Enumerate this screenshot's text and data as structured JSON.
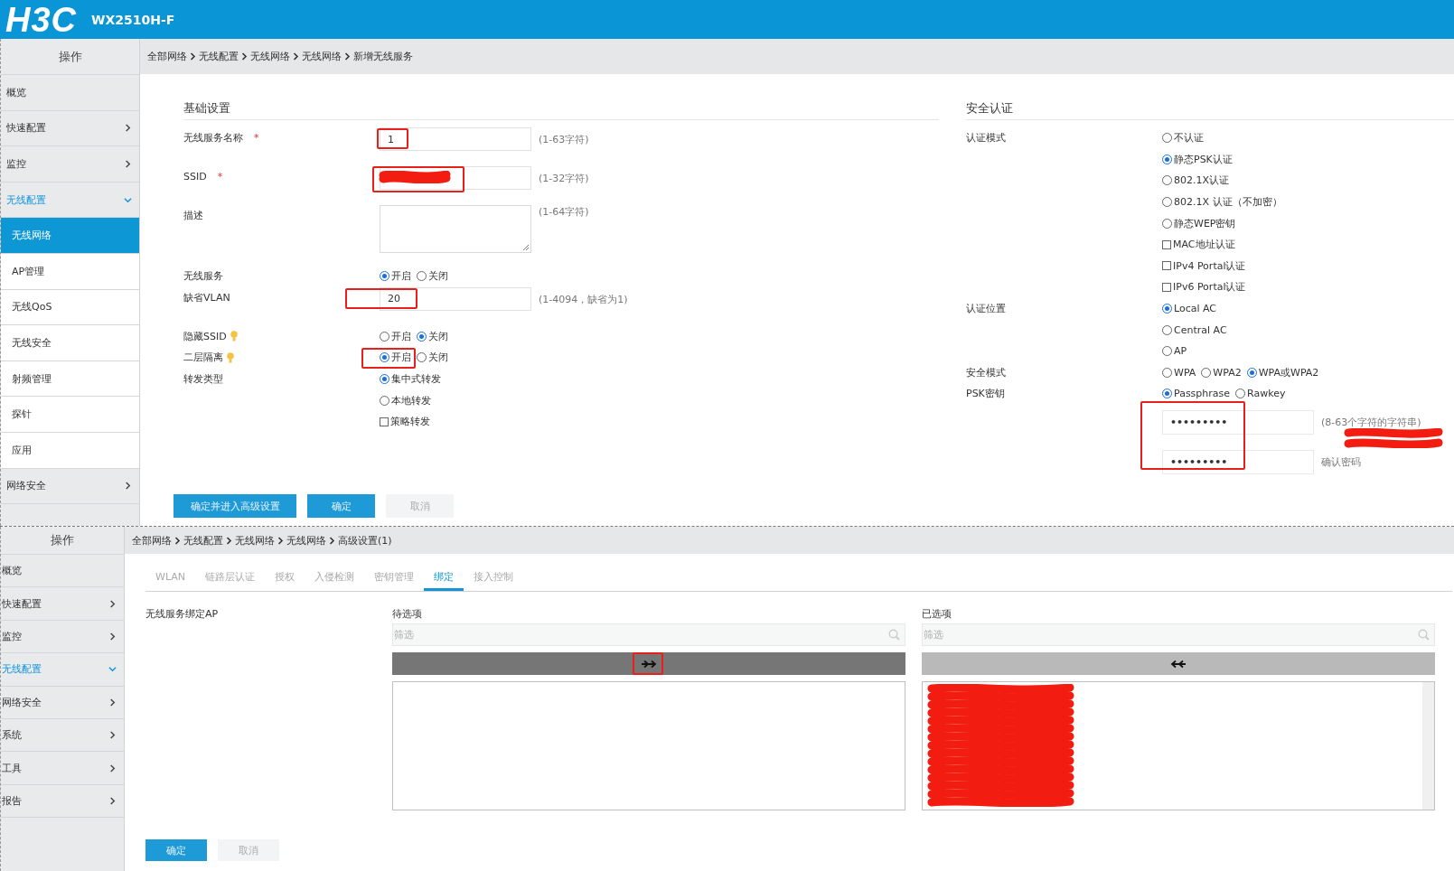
{
  "header": {
    "logo": "H3C",
    "model": "WX2510H-F"
  },
  "top": {
    "sidebar": {
      "title": "操作",
      "items": [
        {
          "label": "概览",
          "kind": "plain",
          "selected": false
        },
        {
          "label": "快速配置",
          "kind": "group",
          "expanded": false,
          "selected": false
        },
        {
          "label": "监控",
          "kind": "group",
          "expanded": false,
          "selected": false
        },
        {
          "label": "无线配置",
          "kind": "group",
          "expanded": true,
          "selected": false
        },
        {
          "label": "无线网络",
          "kind": "sub",
          "selected": true
        },
        {
          "label": "AP管理",
          "kind": "sub",
          "selected": false
        },
        {
          "label": "无线QoS",
          "kind": "sub",
          "selected": false
        },
        {
          "label": "无线安全",
          "kind": "sub",
          "selected": false
        },
        {
          "label": "射频管理",
          "kind": "sub",
          "selected": false
        },
        {
          "label": "探针",
          "kind": "sub",
          "selected": false
        },
        {
          "label": "应用",
          "kind": "sub",
          "selected": false
        },
        {
          "label": "网络安全",
          "kind": "group",
          "expanded": false,
          "selected": false
        }
      ]
    },
    "breadcrumb": [
      "全部网络",
      "无线配置",
      "无线网络",
      "无线网络",
      "新增无线服务"
    ],
    "basic": {
      "title": "基础设置",
      "rows": [
        {
          "kind": "text",
          "label": "无线服务名称",
          "mark": "*",
          "value": "1",
          "hint": "(1-63字符)",
          "annotated": true
        },
        {
          "kind": "text",
          "label": "SSID",
          "mark": "*",
          "value": "",
          "hint": "(1-32字符)",
          "annotated": true,
          "redacted": true
        },
        {
          "kind": "textarea",
          "label": "描述",
          "hint": "(1-64字符)"
        },
        {
          "kind": "inline",
          "label": "无线服务",
          "options": [
            {
              "kind": "radio",
              "label": "开启",
              "selected": true
            },
            {
              "kind": "radio",
              "label": "关闭",
              "selected": false
            }
          ]
        },
        {
          "kind": "text",
          "label": "缺省VLAN",
          "value": "20",
          "hint": "(1-4094，缺省为1)",
          "annotated": true
        },
        {
          "kind": "inline",
          "label": "隐藏SSID",
          "tip": true,
          "options": [
            {
              "kind": "radio",
              "label": "开启",
              "selected": false
            },
            {
              "kind": "radio",
              "label": "关闭",
              "selected": true
            }
          ]
        },
        {
          "kind": "inline",
          "label": "二层隔离",
          "tip": true,
          "annotated": true,
          "options": [
            {
              "kind": "radio",
              "label": "开启",
              "selected": true
            },
            {
              "kind": "radio",
              "label": "关闭",
              "selected": false
            }
          ]
        },
        {
          "kind": "stacked",
          "label": "转发类型",
          "options": [
            {
              "kind": "radio",
              "label": "集中式转发",
              "selected": true
            },
            {
              "kind": "radio",
              "label": "本地转发",
              "selected": false
            },
            {
              "kind": "checkbox",
              "label": "策略转发",
              "selected": false
            }
          ]
        }
      ]
    },
    "security": {
      "title": "安全认证",
      "rows": [
        {
          "kind": "stacked",
          "label": "认证模式",
          "options": [
            {
              "kind": "radio",
              "label": "不认证",
              "selected": false
            },
            {
              "kind": "radio",
              "label": "静态PSK认证",
              "selected": true
            },
            {
              "kind": "radio",
              "label": "802.1X认证",
              "selected": false
            },
            {
              "kind": "radio",
              "label": "802.1X 认证（不加密）",
              "selected": false
            },
            {
              "kind": "radio",
              "label": "静态WEP密钥",
              "selected": false
            },
            {
              "kind": "checkbox",
              "label": "MAC地址认证",
              "selected": false
            },
            {
              "kind": "checkbox",
              "label": "IPv4 Portal认证",
              "selected": false
            },
            {
              "kind": "checkbox",
              "label": "IPv6 Portal认证",
              "selected": false
            }
          ]
        },
        {
          "kind": "stacked",
          "label": "认证位置",
          "options": [
            {
              "kind": "radio",
              "label": "Local AC",
              "selected": true
            },
            {
              "kind": "radio",
              "label": "Central AC",
              "selected": false
            },
            {
              "kind": "radio",
              "label": "AP",
              "selected": false
            }
          ]
        },
        {
          "kind": "inline",
          "label": "安全模式",
          "options": [
            {
              "kind": "radio",
              "label": "WPA",
              "selected": false
            },
            {
              "kind": "radio",
              "label": "WPA2",
              "selected": false
            },
            {
              "kind": "radio",
              "label": "WPA或WPA2",
              "selected": true
            }
          ]
        },
        {
          "kind": "inline",
          "label": "PSK密钥",
          "options": [
            {
              "kind": "radio",
              "label": "Passphrase",
              "selected": true
            },
            {
              "kind": "radio",
              "label": "Rawkey",
              "selected": false
            }
          ]
        }
      ],
      "passwords": {
        "annotated": true,
        "redacted": true,
        "fields": [
          {
            "value": "•••••••••",
            "hint": "(8-63个字符的字符串)"
          },
          {
            "value": "•••••••••",
            "hint": "确认密码"
          }
        ]
      }
    },
    "buttons": [
      {
        "label": "确定并进入高级设置",
        "kind": "primary"
      },
      {
        "label": "确定",
        "kind": "primary"
      },
      {
        "label": "取消",
        "kind": "disabled"
      }
    ]
  },
  "bottom": {
    "sidebar": {
      "title": "操作",
      "items": [
        {
          "label": "概览",
          "kind": "plain",
          "selected": false
        },
        {
          "label": "快速配置",
          "kind": "group",
          "expanded": false,
          "selected": false
        },
        {
          "label": "监控",
          "kind": "group",
          "expanded": false,
          "selected": false
        },
        {
          "label": "无线配置",
          "kind": "group",
          "expanded": true,
          "selected": false
        },
        {
          "label": "网络安全",
          "kind": "group",
          "expanded": false,
          "selected": false
        },
        {
          "label": "系统",
          "kind": "group",
          "expanded": false,
          "selected": false
        },
        {
          "label": "工具",
          "kind": "group",
          "expanded": false,
          "selected": false
        },
        {
          "label": "报告",
          "kind": "group",
          "expanded": false,
          "selected": false
        }
      ]
    },
    "breadcrumb": [
      "全部网络",
      "无线配置",
      "无线网络",
      "无线网络",
      "高级设置(1)"
    ],
    "tabs": [
      {
        "label": "WLAN",
        "selected": false
      },
      {
        "label": "链路层认证",
        "selected": false
      },
      {
        "label": "授权",
        "selected": false
      },
      {
        "label": "入侵检测",
        "selected": false
      },
      {
        "label": "密钥管理",
        "selected": false
      },
      {
        "label": "绑定",
        "selected": true
      },
      {
        "label": "接入控制",
        "selected": false
      }
    ],
    "field_label": "无线服务绑定AP",
    "panels": [
      {
        "kind": "available",
        "title": "待选项",
        "placeholder": "筛选",
        "annotated": true
      },
      {
        "kind": "chosen",
        "title": "已选项",
        "placeholder": "筛选",
        "redacted": true
      }
    ],
    "buttons": [
      {
        "label": "确定",
        "kind": "primary"
      },
      {
        "label": "取消",
        "kind": "disabled"
      }
    ]
  }
}
